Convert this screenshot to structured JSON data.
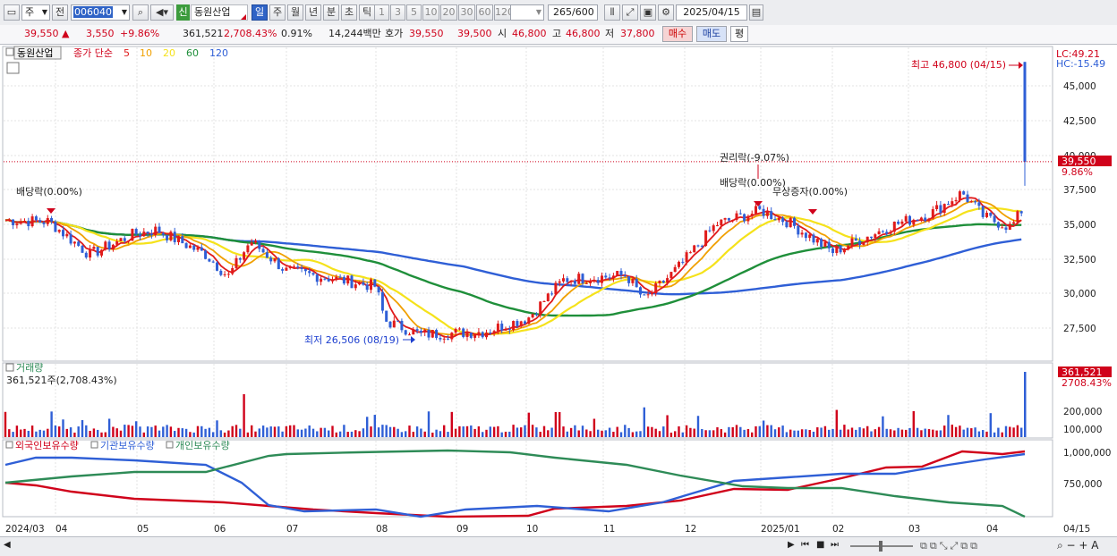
{
  "toolbar": {
    "period_select": "주",
    "prev_label": "전",
    "stock_code": "006040",
    "credit_badge": "신",
    "stock_name": "동원산업",
    "periods": [
      "일",
      "주",
      "월",
      "년",
      "분",
      "초",
      "틱"
    ],
    "active_period": "일",
    "numbers": [
      "1",
      "3",
      "5",
      "10",
      "20",
      "30",
      "60",
      "120"
    ],
    "count_value": "265",
    "count_max": "/600",
    "date_value": "2025/04/15"
  },
  "quote": {
    "price": "39,550",
    "arrow": "▲",
    "change": "3,550",
    "change_pct": "+9.86%",
    "volume": "361,521",
    "volume_ratio": "2,708.43%",
    "turnover_pct": "0.91%",
    "amount": "14,244백만",
    "hoga_label": "호가",
    "ask": "39,550",
    "bid": "39,500",
    "open_label": "시",
    "open": "46,800",
    "high_label": "고",
    "high": "46,800",
    "low_label": "저",
    "low": "37,800",
    "buy_label": "매수",
    "sell_label": "매도",
    "eval_label": "평"
  },
  "price_panel": {
    "name_tag": "동원산업",
    "ma_label": "종가 단순",
    "ma_periods": [
      "5",
      "10",
      "20",
      "60",
      "120"
    ],
    "ma_colors": [
      "#e01b1b",
      "#f0a000",
      "#f5e21b",
      "#1f8f3a",
      "#2f5fd6"
    ],
    "lc": "LC:49.21",
    "hc": "HC:-15.49",
    "y_ticks": [
      "45,000",
      "42,500",
      "40,000",
      "37,500",
      "35,000",
      "32,500",
      "30,000",
      "27,500"
    ],
    "current_price_tag": "39,550",
    "current_pct_tag": "9.86%",
    "annotations": {
      "high": "최고 46,800 (04/15)",
      "low": "최저 26,506 (08/19)",
      "div1": "배당락(0.00%)",
      "rights": "권리락(-9.07%)",
      "div2": "배당락(0.00%)",
      "bonus": "무상증자(0.00%)"
    }
  },
  "volume_panel": {
    "title": "거래량",
    "value": "361,521주(2,708.43%)",
    "tag_value": "361,521",
    "tag_pct": "2708.43%",
    "y_ticks": [
      "200,000",
      "100,000"
    ]
  },
  "holding_panel": {
    "series": [
      {
        "name": "외국인보유수량",
        "color": "#d0021b"
      },
      {
        "name": "기관보유수량",
        "color": "#2f5fd6"
      },
      {
        "name": "개인보유수량",
        "color": "#2e8b57"
      }
    ],
    "y_ticks": [
      "1,000,000",
      "750,000"
    ]
  },
  "x_axis": [
    "2024/03",
    "04",
    "05",
    "06",
    "07",
    "08",
    "09",
    "10",
    "11",
    "12",
    "2025/01",
    "02",
    "03",
    "04",
    "04/15"
  ]
}
